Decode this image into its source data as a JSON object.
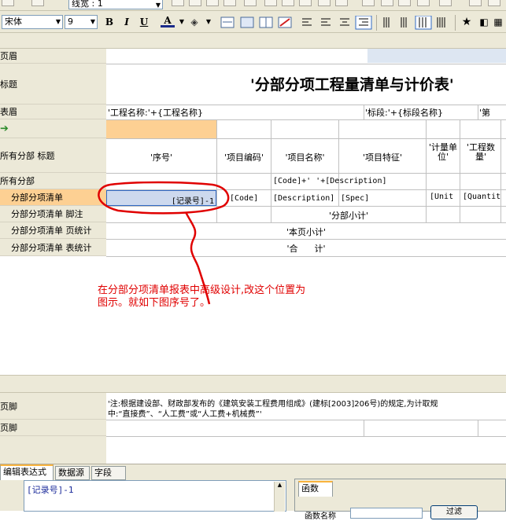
{
  "toolbar": {
    "line_combo": "线宽 : 1",
    "font_name": "宋体",
    "font_size": "9",
    "bold": "B",
    "italic": "I",
    "underline": "U",
    "font_color_label": "A"
  },
  "bands": {
    "page_header": "页眉",
    "title": "标题",
    "table_header": "表眉",
    "all_sections_title": "所有分部 标题",
    "all_sections": "所有分部",
    "section_items": "分部分项清单",
    "section_items_footer": "分部分项清单 脚注",
    "section_items_page_stat": "分部分项清单 页统计",
    "section_items_table_stat": "分部分项清单 表统计",
    "page_footer": "页脚",
    "page_footer2": "页脚"
  },
  "report": {
    "title": "'分部分项工程量清单与计价表'",
    "project_name": "'工程名称:'+{工程名称}",
    "bid_section": "'标段:'+{标段名称}",
    "page_prefix": "'第",
    "col_seq": "'序号'",
    "col_code": "'项目编码'",
    "col_name": "'项目名称'",
    "col_feature": "'项目特征'",
    "col_unit": "'计量单位'",
    "col_qty": "'工程数量'",
    "group_expr": "[Code]+' '+[Description]",
    "cell_seq": "[记录号]-1",
    "cell_code": "[Code]",
    "cell_desc": "[Description]",
    "cell_spec": "[Spec]",
    "cell_unit": "[Unit",
    "cell_qty": "[Quantit",
    "subtotal": "'分部小计'",
    "page_subtotal": "'本页小计'",
    "total": "'合      计'",
    "footer_note_line1": "'注:根据建设部、财政部发布的《建筑安装工程费用组成》(建标[2003]206号)的规定,为计取规",
    "footer_note_line2": "中:“直接费”、“人工费”或“人工费+机械费”'"
  },
  "annotation": {
    "line1": "在分部分项清单报表中高级设计,改这个位置为",
    "line2": "图示。就如下图序号了。",
    "color": "#e00000"
  },
  "bottom_panel": {
    "tabs": [
      "编辑表达式",
      "数据源",
      "字段"
    ],
    "expression": "[记录号]-1",
    "functions_tab": "函数",
    "param_label": "函数名称",
    "filter_button": "过滤"
  }
}
